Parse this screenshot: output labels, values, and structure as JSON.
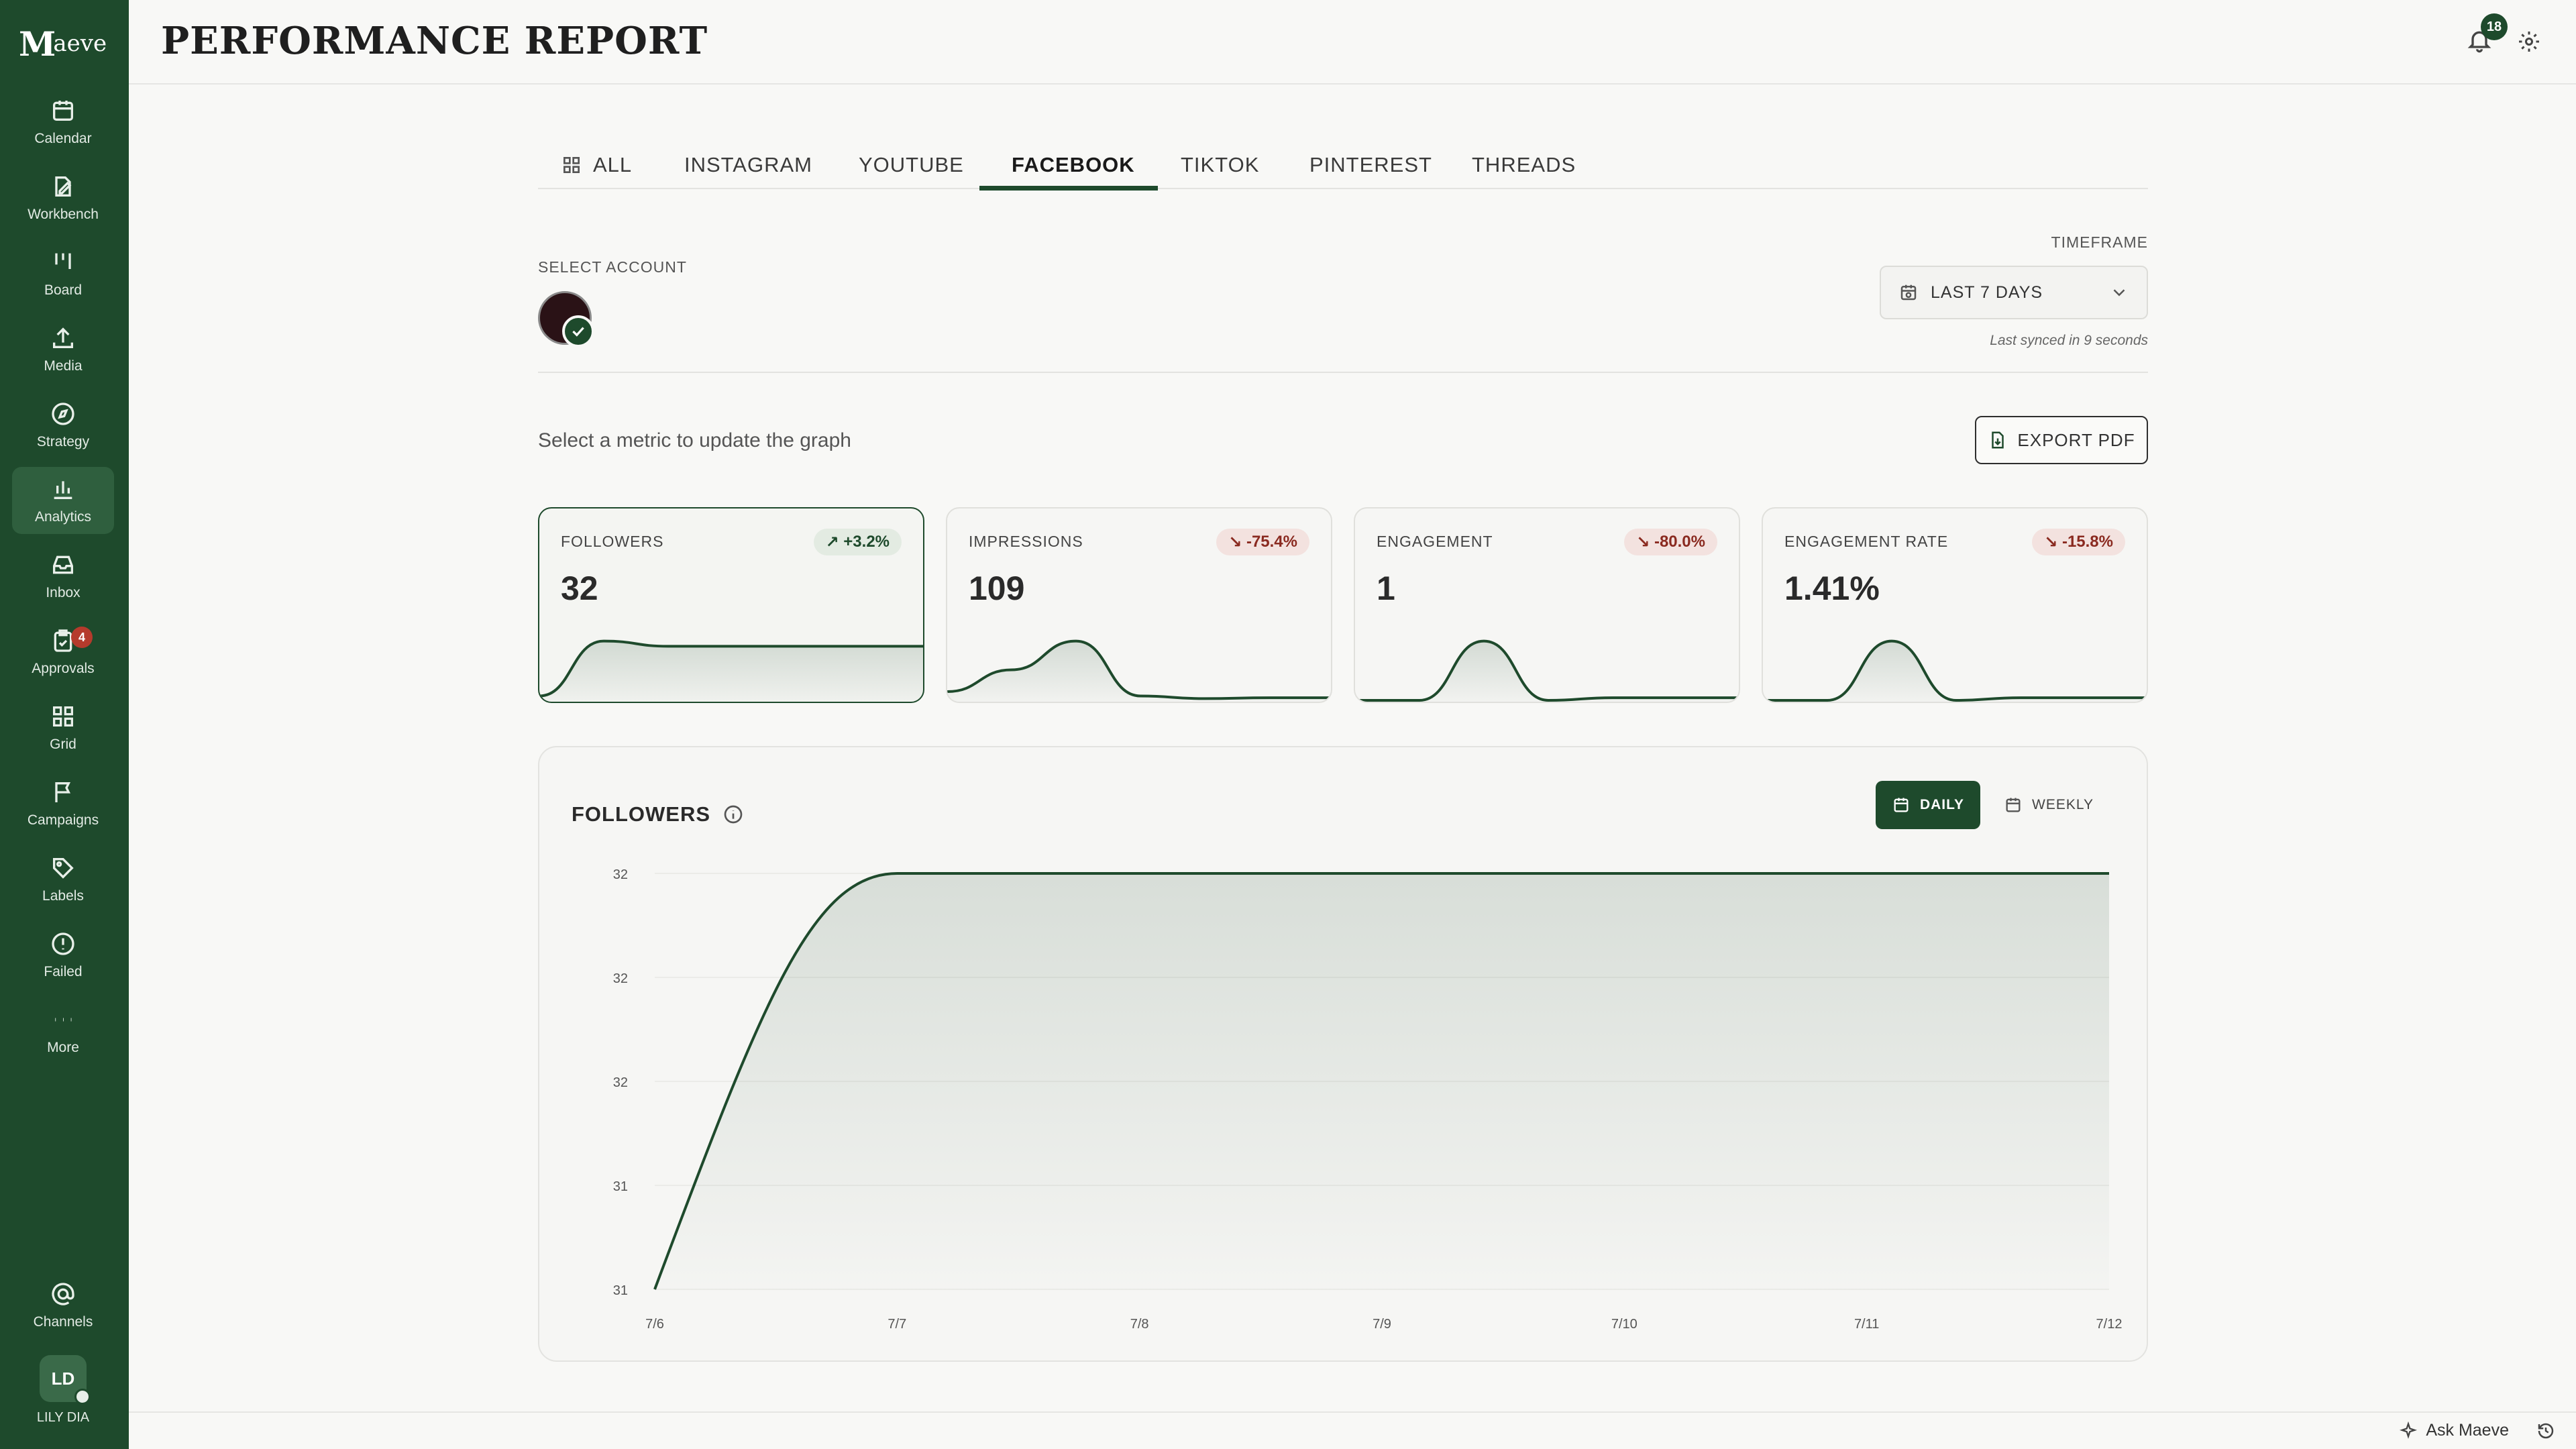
{
  "app": {
    "logo_mark": "M",
    "logo_word": "aeve"
  },
  "sidebar": {
    "items": [
      {
        "label": "Calendar",
        "icon": "calendar-icon"
      },
      {
        "label": "Workbench",
        "icon": "edit-icon"
      },
      {
        "label": "Board",
        "icon": "board-icon"
      },
      {
        "label": "Media",
        "icon": "upload-icon"
      },
      {
        "label": "Strategy",
        "icon": "compass-icon"
      },
      {
        "label": "Analytics",
        "icon": "bar-chart-icon",
        "active": true
      },
      {
        "label": "Inbox",
        "icon": "inbox-icon"
      },
      {
        "label": "Approvals",
        "icon": "clipboard-check-icon",
        "badge": "4"
      },
      {
        "label": "Grid",
        "icon": "grid-icon"
      },
      {
        "label": "Campaigns",
        "icon": "flag-icon"
      },
      {
        "label": "Labels",
        "icon": "tag-icon"
      },
      {
        "label": "Failed",
        "icon": "alert-icon"
      },
      {
        "label": "More",
        "icon": "more-icon"
      }
    ],
    "channels_label": "Channels",
    "user": {
      "initials": "LD",
      "name": "LILY DIA"
    }
  },
  "header": {
    "title": "PERFORMANCE REPORT",
    "notifications": "18"
  },
  "tabs": [
    "ALL",
    "INSTAGRAM",
    "YOUTUBE",
    "FACEBOOK",
    "TIKTOK",
    "PINTEREST",
    "THREADS"
  ],
  "active_tab": "FACEBOOK",
  "account": {
    "label": "SELECT ACCOUNT"
  },
  "timeframe": {
    "label": "TIMEFRAME",
    "value": "LAST 7 DAYS",
    "synced": "Last synced in 9 seconds"
  },
  "hint": "Select a metric to update the graph",
  "export_label": "EXPORT PDF",
  "metrics": [
    {
      "name": "FOLLOWERS",
      "value": "32",
      "change": "+3.2%",
      "direction": "up",
      "selected": true,
      "spark": [
        0.05,
        0.68,
        0.62,
        0.62,
        0.62,
        0.62,
        0.62
      ]
    },
    {
      "name": "IMPRESSIONS",
      "value": "109",
      "change": "-75.4%",
      "direction": "down",
      "spark": [
        0.1,
        0.35,
        0.68,
        0.05,
        0.02,
        0.03,
        0.03
      ]
    },
    {
      "name": "ENGAGEMENT",
      "value": "1",
      "change": "-80.0%",
      "direction": "down",
      "spark": [
        0.0,
        0.0,
        0.68,
        0.0,
        0.03,
        0.03,
        0.03
      ]
    },
    {
      "name": "ENGAGEMENT RATE",
      "value": "1.41%",
      "change": "-15.8%",
      "direction": "down",
      "spark": [
        0.0,
        0.0,
        0.68,
        0.0,
        0.03,
        0.03,
        0.03
      ]
    }
  ],
  "chart": {
    "title": "FOLLOWERS",
    "daily_label": "DAILY",
    "weekly_label": "WEEKLY"
  },
  "chart_data": {
    "type": "area",
    "title": "FOLLOWERS",
    "x": [
      "7/6",
      "7/7",
      "7/8",
      "7/9",
      "7/10",
      "7/11",
      "7/12"
    ],
    "series": [
      {
        "values": [
          31,
          32,
          32,
          32,
          32,
          32,
          32
        ]
      }
    ],
    "y_tick_labels": [
      "32",
      "32",
      "32",
      "31",
      "31"
    ],
    "ylim": [
      31,
      32
    ],
    "color": "#1e4a2c",
    "grid": true
  },
  "footer": {
    "ask_label": "Ask Maeve"
  }
}
